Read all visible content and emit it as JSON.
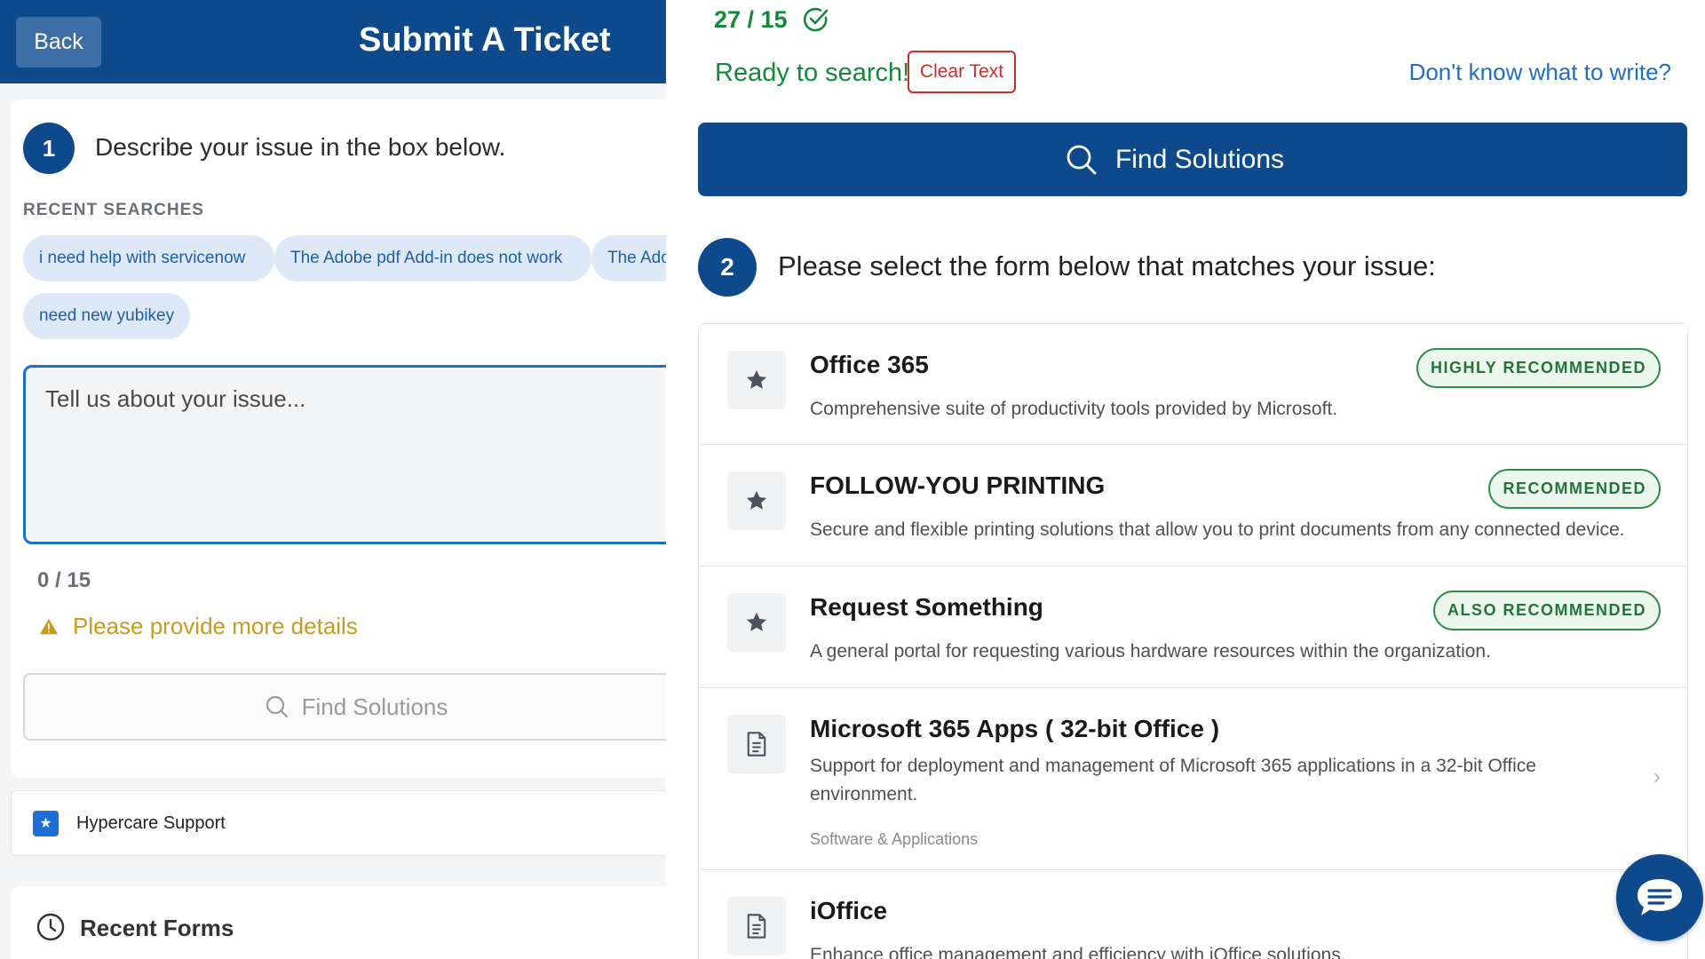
{
  "header": {
    "back_label": "Back",
    "title": "Submit A Ticket"
  },
  "step1": {
    "number": "1",
    "text": "Describe your issue in the box below.",
    "recent_label": "RECENT SEARCHES",
    "recent_searches": [
      "i need help with servicenow",
      "The Adobe pdf Add-in does not work",
      "The Adobe",
      "need new yubikey"
    ],
    "textarea_placeholder": "Tell us about your issue...",
    "textarea_value": "",
    "count": "0 / 15",
    "warning": "Please provide more details",
    "find_label": "Find Solutions"
  },
  "hypercare": {
    "label": "Hypercare Support"
  },
  "recent_forms": {
    "label": "Recent Forms"
  },
  "right": {
    "count": "27 / 15",
    "ready_text": "Ready to search!",
    "clear_label": "Clear Text",
    "help_link": "Don't know what to write?",
    "find_label": "Find Solutions"
  },
  "step2": {
    "number": "2",
    "text": "Please select the form below that matches your issue:",
    "forms": [
      {
        "title": "Office 365",
        "desc": "Comprehensive suite of productivity tools provided by Microsoft.",
        "badge": "HIGHLY RECOMMENDED",
        "icon": "star-icon"
      },
      {
        "title": "FOLLOW-YOU PRINTING",
        "desc": "Secure and flexible printing solutions that allow you to print documents from any connected device.",
        "badge": "RECOMMENDED",
        "icon": "star-icon"
      },
      {
        "title": "Request Something",
        "desc": "A general portal for requesting various hardware resources within the organization.",
        "badge": "ALSO RECOMMENDED",
        "icon": "star-icon"
      },
      {
        "title": "Microsoft 365 Apps ( 32-bit Office )",
        "desc": "Support for deployment and management of Microsoft 365 applications in a 32-bit Office environment.",
        "category": "Software & Applications",
        "icon": "document-icon"
      },
      {
        "title": "iOffice",
        "desc": "Enhance office management and efficiency with iOffice solutions.",
        "icon": "document-icon"
      }
    ]
  },
  "colors": {
    "brand": "#0e4a8b",
    "success": "#13893a",
    "warning": "#c99a1c",
    "danger": "#cf2b2b",
    "link": "#1f6fc0"
  }
}
